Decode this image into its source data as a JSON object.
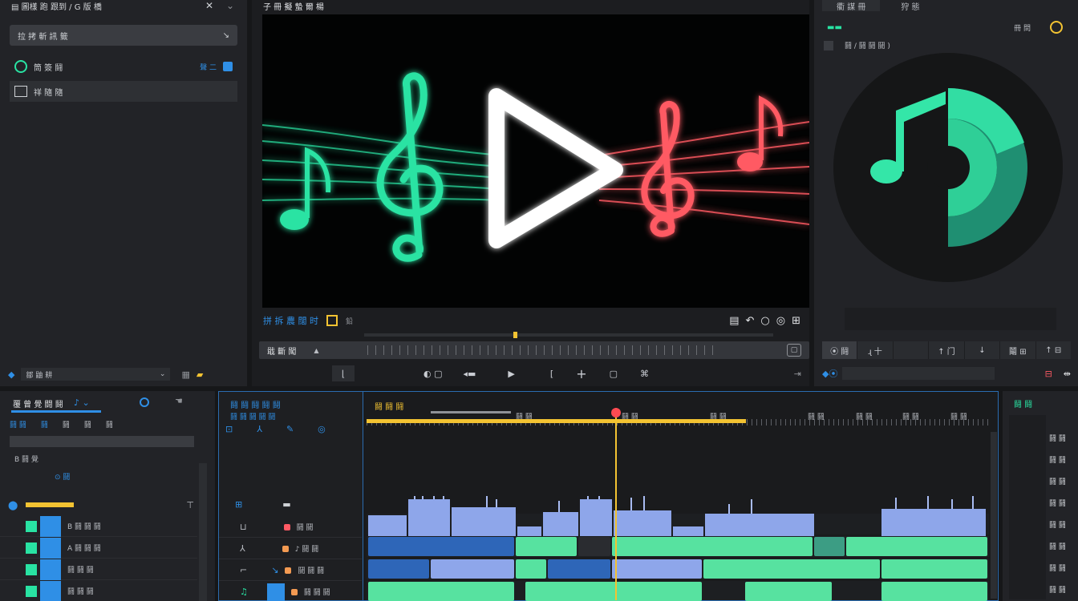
{
  "colors": {
    "accent_blue": "#2f8fe6",
    "accent_green": "#29e3a3",
    "accent_red": "#ff5a64",
    "accent_yellow": "#f3c332",
    "clip_blue": "#8ea6ea",
    "clip_green": "#57e2a0",
    "clip_teal": "#3c9d84"
  },
  "left_panel": {
    "title": "▤ 圖樣 跑 跟到 / G 版 橋",
    "search_placeholder": "拉 拷 斬 訊 籤",
    "items": [
      {
        "icon": "music-library-icon",
        "label": "筒 簽 鬪",
        "badge": "聲 二"
      },
      {
        "icon": "image-folder-icon",
        "label": "祥 隨 隨"
      }
    ],
    "footer_label": "鄒 鼬 耕"
  },
  "preview": {
    "title": "子 冊 擬 蟄 爾 楊",
    "clip_name": "拼 拆 農 闊 时",
    "clip_extra": "鉛",
    "scrub_label": "戢 斷 闖",
    "controls": [
      "skip-back-icon",
      "prev-frame-icon",
      "rewind-icon",
      "play-icon",
      "mark-in-icon",
      "add-icon",
      "stop-icon",
      "snapshot-icon",
      "fit-icon"
    ],
    "status_icons": [
      "export-icon",
      "undo-icon",
      "loop-icon",
      "search-icon",
      "fullscreen-icon"
    ]
  },
  "inspector": {
    "tabs": [
      "衢 謀 冊",
      "狩 態"
    ],
    "header_label": "冊 問",
    "option_label": "鬪 / 鬪 鬪 鬪 )",
    "tools": [
      "⦿ 鬪",
      "ɻ 十",
      "",
      "↑ 门",
      "↓",
      "鬮 ⊞",
      "↑ ⊟"
    ],
    "footer_value": ""
  },
  "tracks_header": {
    "title": "覆 曾 覺 闘 鬪",
    "toolbar": [
      "鬪 鬪",
      "鬪",
      "鬪",
      "鬪",
      "鬪"
    ],
    "track_group": "B 鬪 覺",
    "group_badge": "⊙ 鬪",
    "tracks": [
      "B 鬪 鬪 鬪",
      "A 鬪 鬪 鬪",
      "鬪 鬪 鬪",
      "鬪 鬪 鬪"
    ]
  },
  "tracks_mid": {
    "title": "鬪 鬪 鬪 鬪 鬪",
    "subtitle": "鬪 鬪 鬪 鬪 鬪",
    "rows": [
      "鬪 鬪",
      "♪ 鬪 鬪",
      "鬪 鬪 鬪",
      "鬪 鬪 鬪"
    ]
  },
  "timeline": {
    "title": "鬪 鬪 鬪",
    "ruler_marks": [
      "鬪 鬪",
      "鬪 鬪",
      "鬪 鬪",
      "鬪 鬪",
      "鬪 鬪",
      "鬪 鬪",
      "鬪 鬪"
    ],
    "playhead_fraction": 0.4,
    "work_area_fraction": 0.61
  },
  "mixer": {
    "title": "鬪 鬪",
    "labels": [
      "鬪 鬪",
      "鬪 鬪",
      "鬪 鬪",
      "鬪 鬪",
      "鬪 鬪",
      "鬪 鬪",
      "鬪 鬪",
      "鬪 鬪"
    ]
  }
}
